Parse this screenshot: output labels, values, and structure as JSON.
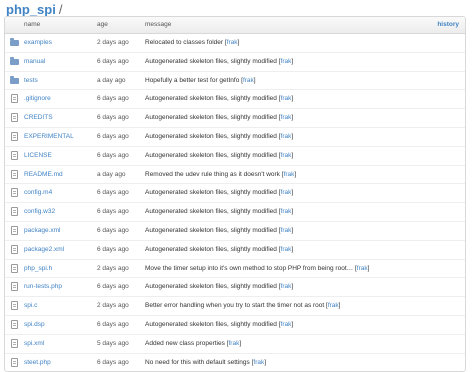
{
  "breadcrumb": {
    "repo": "php_spi",
    "separator": "/"
  },
  "table": {
    "headers": {
      "name": "name",
      "age": "age",
      "message": "message",
      "history": "history"
    },
    "rows": [
      {
        "name": "examples",
        "type": "folder",
        "age": "2 days ago",
        "message": "Relocated to classes folder",
        "author": "frak"
      },
      {
        "name": "manual",
        "type": "folder",
        "age": "6 days ago",
        "message": "Autogenerated skeleton files, slightly modified",
        "author": "frak"
      },
      {
        "name": "tests",
        "type": "folder",
        "age": "a day ago",
        "message": "Hopefully a better test for getInfo",
        "author": "frak"
      },
      {
        "name": ".gitignore",
        "type": "file",
        "age": "6 days ago",
        "message": "Autogenerated skeleton files, slightly modified",
        "author": "frak"
      },
      {
        "name": "CREDITS",
        "type": "file",
        "age": "6 days ago",
        "message": "Autogenerated skeleton files, slightly modified",
        "author": "frak"
      },
      {
        "name": "EXPERIMENTAL",
        "type": "file",
        "age": "6 days ago",
        "message": "Autogenerated skeleton files, slightly modified",
        "author": "frak"
      },
      {
        "name": "LICENSE",
        "type": "file",
        "age": "6 days ago",
        "message": "Autogenerated skeleton files, slightly modified",
        "author": "frak"
      },
      {
        "name": "README.md",
        "type": "file",
        "age": "a day ago",
        "message": "Removed the udev rule thing as it doesn't work",
        "author": "frak"
      },
      {
        "name": "config.m4",
        "type": "file",
        "age": "6 days ago",
        "message": "Autogenerated skeleton files, slightly modified",
        "author": "frak"
      },
      {
        "name": "config.w32",
        "type": "file",
        "age": "6 days ago",
        "message": "Autogenerated skeleton files, slightly modified",
        "author": "frak"
      },
      {
        "name": "package.xml",
        "type": "file",
        "age": "6 days ago",
        "message": "Autogenerated skeleton files, slightly modified",
        "author": "frak"
      },
      {
        "name": "package2.xml",
        "type": "file",
        "age": "6 days ago",
        "message": "Autogenerated skeleton files, slightly modified",
        "author": "frak"
      },
      {
        "name": "php_spi.h",
        "type": "file",
        "age": "2 days ago",
        "message": "Move the timer setup into it's own method to stop PHP from being root…",
        "author": "frak"
      },
      {
        "name": "run-tests.php",
        "type": "file",
        "age": "6 days ago",
        "message": "Autogenerated skeleton files, slightly modified",
        "author": "frak"
      },
      {
        "name": "spi.c",
        "type": "file",
        "age": "2 days ago",
        "message": "Better error handling when you try to start the timer not as root",
        "author": "frak"
      },
      {
        "name": "spi.dsp",
        "type": "file",
        "age": "6 days ago",
        "message": "Autogenerated skeleton files, slightly modified",
        "author": "frak"
      },
      {
        "name": "spi.xml",
        "type": "file",
        "age": "5 days ago",
        "message": "Added new class properties",
        "author": "frak"
      },
      {
        "name": "steet.php",
        "type": "file",
        "age": "6 days ago",
        "message": "No need for this with default settings",
        "author": "frak"
      }
    ]
  },
  "colors": {
    "link": "#4183c4",
    "folder": "#7a9ec7",
    "text": "#333333",
    "muted": "#555555",
    "border": "#d8d8d8"
  }
}
